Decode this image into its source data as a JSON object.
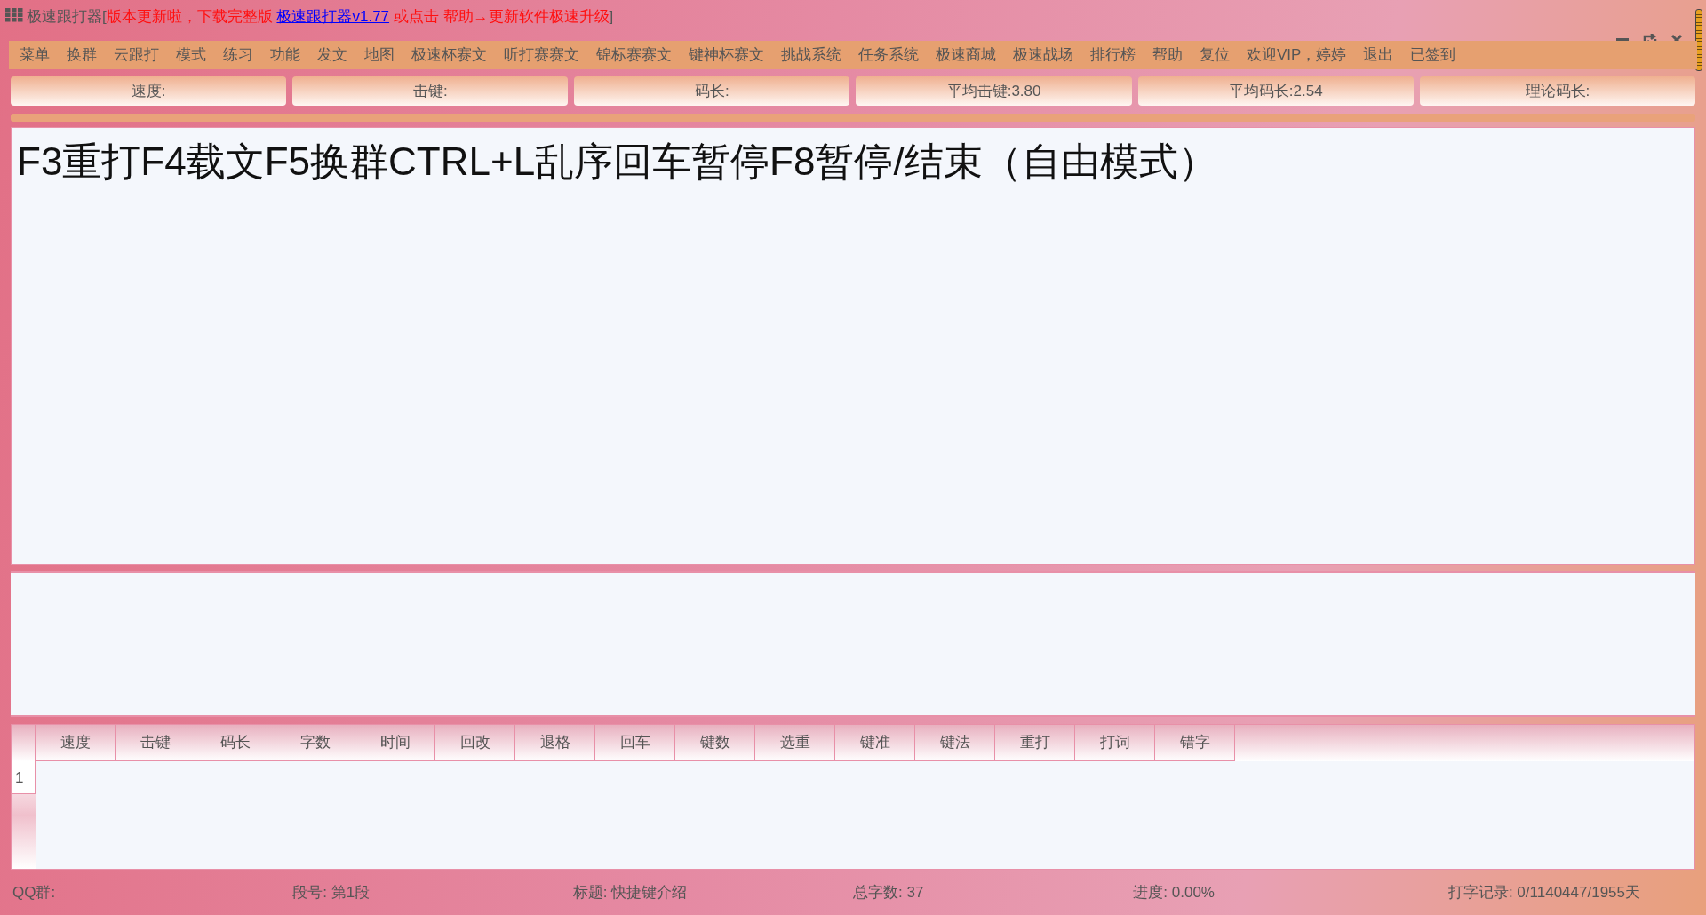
{
  "window": {
    "app_name": "极速跟打器",
    "notice_parts": [
      "[",
      "版本更新啦，下载完整版 ",
      "极速跟打器v1.77",
      " 或点击 帮助→更新软件极速升级",
      "]"
    ]
  },
  "menu": [
    "菜单",
    "换群",
    "云跟打",
    "模式",
    "练习",
    "功能",
    "发文",
    "地图",
    "极速杯赛文",
    "听打赛赛文",
    "锦标赛赛文",
    "键神杯赛文",
    "挑战系统",
    "任务系统",
    "极速商城",
    "极速战场",
    "排行榜",
    "帮助",
    "复位",
    "欢迎VIP，婷婷",
    "退出",
    "已签到"
  ],
  "stats": [
    "速度:",
    "击键:",
    "码长:",
    "平均击键:3.80",
    "平均码长:2.54",
    "理论码长:"
  ],
  "text_area": {
    "content": "F3重打F4载文F5换群CTRL+L乱序回车暂停F8暂停/结束（自由模式）"
  },
  "table": {
    "columns": [
      "速度",
      "击键",
      "码长",
      "字数",
      "时间",
      "回改",
      "退格",
      "回车",
      "键数",
      "选重",
      "键准",
      "键法",
      "重打",
      "打词",
      "错字"
    ],
    "rows": [
      {
        "index": "1"
      }
    ]
  },
  "status_bar": [
    "QQ群:",
    "段号: 第1段",
    "标题: 快捷键介绍",
    "总字数: 37",
    "进度: 0.00%",
    "打字记录: 0/1140447/1955天"
  ]
}
